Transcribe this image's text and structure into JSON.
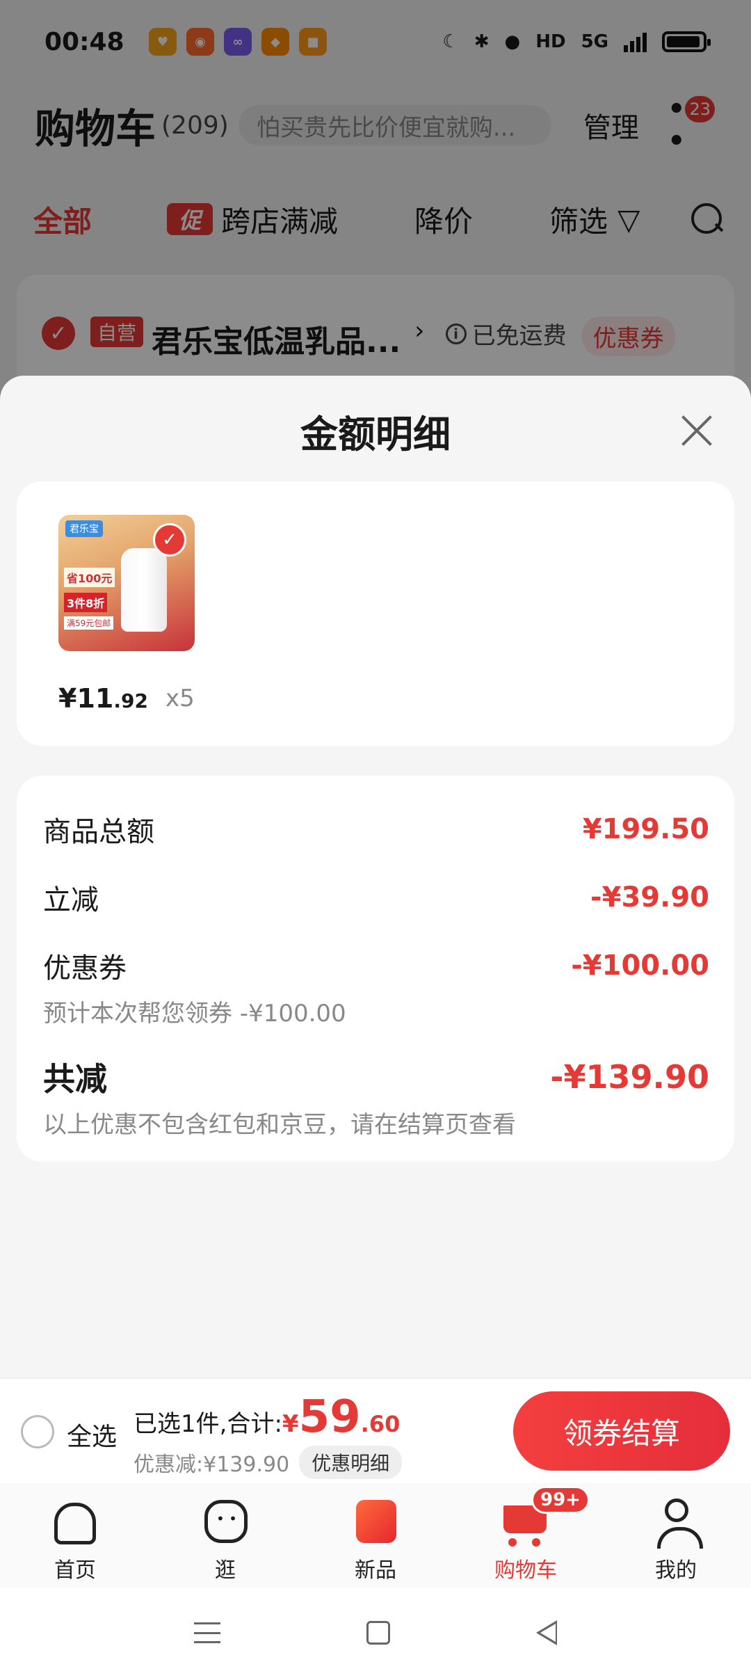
{
  "status_bar": {
    "time": "00:48",
    "apps": [
      {
        "name": "app-icon-orange",
        "color": "#f6a51b"
      },
      {
        "name": "app-icon-kuaishou",
        "color": "#ff6a2b"
      },
      {
        "name": "app-icon-purple",
        "color": "#7a5cf0"
      },
      {
        "name": "app-icon-taobao",
        "color": "#ff8a00"
      },
      {
        "name": "app-icon-xianyu",
        "color": "#ff9a1a"
      }
    ],
    "network": "5G",
    "hd_label": "HD"
  },
  "cart_header": {
    "title": "购物车",
    "count": "(209)",
    "search_placeholder": "怕买贵先比价便宜就购...",
    "manage_label": "管理",
    "message_badge": "23"
  },
  "filters": {
    "all": "全部",
    "promo_tag": "促",
    "cross_store": "跨店满减",
    "price_drop": "降价",
    "screen": "筛选"
  },
  "store": {
    "self_tag": "自营",
    "name": "君乐宝低温乳品...",
    "free_shipping": "已免运费",
    "coupon": "优惠券"
  },
  "sheet": {
    "title": "金额明细",
    "product": {
      "thumb_brand": "君乐宝",
      "thumb_line1": "省100元",
      "thumb_line2": "3件8折",
      "thumb_line3": "满59元包邮",
      "price_yen": "¥",
      "price_int": "11",
      "price_dec": ".92",
      "qty": "x5"
    },
    "details": {
      "goods_total_label": "商品总额",
      "goods_total_value": "¥199.50",
      "instant_label": "立减",
      "instant_value": "-¥39.90",
      "coupon_label": "优惠券",
      "coupon_value": "-¥100.00",
      "coupon_note": "预计本次帮您领券 -¥100.00",
      "total_label": "共减",
      "total_value": "-¥139.90",
      "total_note": "以上优惠不包含红包和京豆，请在结算页查看"
    }
  },
  "checkout": {
    "select_all": "全选",
    "summary_text": "已选1件,合计:",
    "summary_yen": "¥",
    "summary_int": "59",
    "summary_dec": ".60",
    "discount_text": "优惠减:¥139.90",
    "detail_chip": "优惠明细",
    "button": "领券结算"
  },
  "tabs": [
    {
      "label": "首页"
    },
    {
      "label": "逛"
    },
    {
      "label": "新品"
    },
    {
      "label": "购物车",
      "badge": "99+"
    },
    {
      "label": "我的"
    }
  ],
  "colors": {
    "accent": "#e53935",
    "background": "#f5f5f5"
  }
}
